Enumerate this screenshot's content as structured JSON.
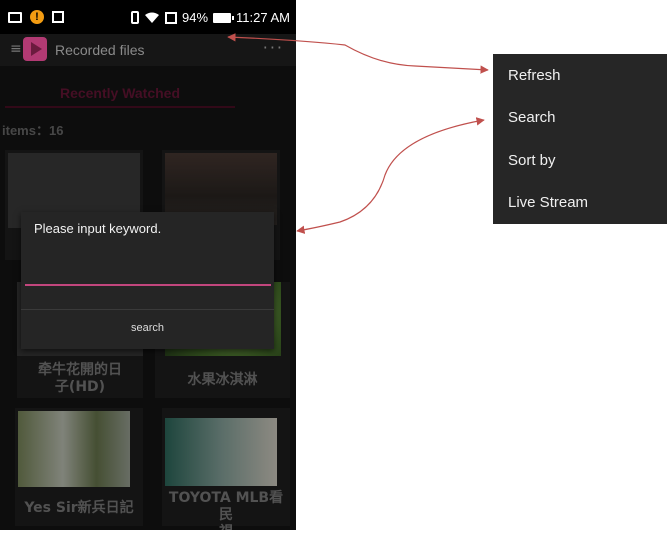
{
  "status_bar": {
    "battery": "94%",
    "time": "11:27 AM"
  },
  "app_bar": {
    "title": "Recorded files",
    "overflow": "···"
  },
  "tabs": [
    {
      "label": "Recently Watched"
    }
  ],
  "items_label": "items：16",
  "grid": [
    {
      "title": ""
    },
    {
      "title": ""
    },
    {
      "title": "牵牛花開的日\n子(HD)"
    },
    {
      "title": "水果冰淇淋"
    },
    {
      "title": "Yes Sir新兵日記"
    },
    {
      "title": "TOYOTA MLB看民\n視"
    }
  ],
  "dialog": {
    "message": "Please input keyword.",
    "input_value": "",
    "button": "search"
  },
  "menu": {
    "items": [
      {
        "label": "Refresh"
      },
      {
        "label": "Search"
      },
      {
        "label": "Sort by"
      },
      {
        "label": "Live Stream"
      }
    ]
  },
  "colors": {
    "accent": "#c2467d",
    "arrow": "#c0504d",
    "tab_text": "#6a1638"
  }
}
